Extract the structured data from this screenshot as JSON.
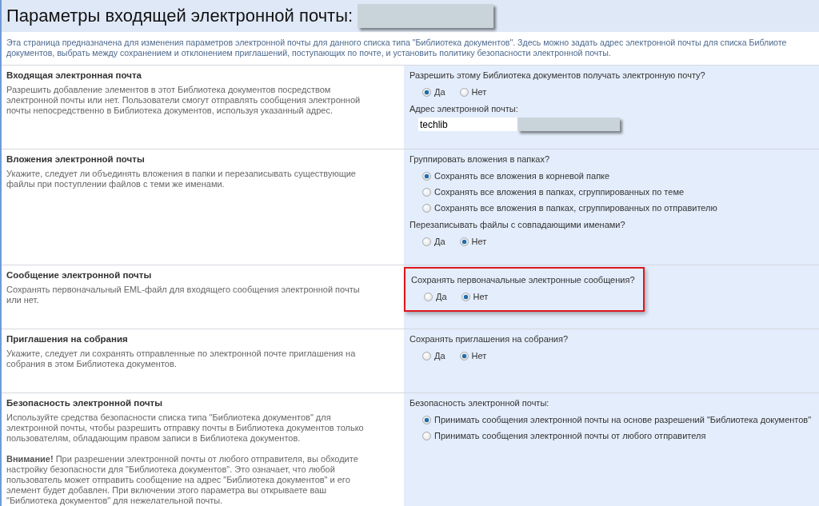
{
  "page": {
    "title": "Параметры входящей электронной почты:",
    "intro_lines": [
      "Эта страница предназначена для изменения параметров электронной почты для данного списка типа \"Библиотека документов\". Здесь можно задать адрес электронной почты для списка Библиоте",
      "документов, выбрать между сохранением и отклонением приглашений, поступающих по почте, и установить политику безопасности электронной почты."
    ]
  },
  "sections": [
    {
      "title": "Входящая электронная почта",
      "description": [
        "Разрешить добавление элементов в этот Библиотека документов посредством электронной почты или нет. Пользователи смогут отправлять сообщения электронной почты непосредственно в Библиотека документов, используя указанный адрес."
      ],
      "highlighted": false,
      "controls": [
        {
          "kind": "question",
          "text": "Разрешить этому Библиотека документов получать электронную почту?"
        },
        {
          "kind": "inline-radios",
          "options": [
            {
              "label": "Да",
              "selected": true
            },
            {
              "label": "Нет",
              "selected": false
            }
          ]
        },
        {
          "kind": "question",
          "text": "Адрес электронной почты:"
        },
        {
          "kind": "text-field",
          "value": "techlib"
        }
      ]
    },
    {
      "title": "Вложения электронной почты",
      "description": [
        "Укажите, следует ли объединять вложения в папки и перезаписывать существующие файлы при поступлении файлов с теми же именами."
      ],
      "highlighted": false,
      "controls": [
        {
          "kind": "question",
          "text": "Группировать вложения в папках?"
        },
        {
          "kind": "stacked-radios",
          "options": [
            {
              "label": "Сохранять все вложения в корневой папке",
              "selected": true
            },
            {
              "label": "Сохранять все вложения в папках, сгруппированных по теме",
              "selected": false
            },
            {
              "label": "Сохранять все вложения в папках, сгруппированных по отправителю",
              "selected": false
            }
          ]
        },
        {
          "kind": "question",
          "text": "Перезаписывать файлы с совпадающими именами?"
        },
        {
          "kind": "inline-radios",
          "options": [
            {
              "label": "Да",
              "selected": false
            },
            {
              "label": "Нет",
              "selected": true
            }
          ]
        }
      ]
    },
    {
      "title": "Сообщение электронной почты",
      "description": [
        "Сохранять первоначальный EML-файл для входящего сообщения электронной почты или нет."
      ],
      "highlighted": true,
      "controls": [
        {
          "kind": "question",
          "text": "Сохранять первоначальные электронные сообщения?"
        },
        {
          "kind": "inline-radios",
          "options": [
            {
              "label": "Да",
              "selected": false
            },
            {
              "label": "Нет",
              "selected": true
            }
          ]
        }
      ]
    },
    {
      "title": "Приглашения на собрания",
      "description": [
        "Укажите, следует ли сохранять отправленные по электронной почте приглашения на собрания в этом Библиотека документов."
      ],
      "highlighted": false,
      "controls": [
        {
          "kind": "question",
          "text": "Сохранять приглашения на собрания?"
        },
        {
          "kind": "inline-radios",
          "options": [
            {
              "label": "Да",
              "selected": false
            },
            {
              "label": "Нет",
              "selected": true
            }
          ]
        }
      ]
    },
    {
      "title": "Безопасность электронной почты",
      "description": [
        "Используйте средства безопасности списка типа \"Библиотека документов\" для электронной почты, чтобы разрешить отправку почты в Библиотека документов только пользователям, обладающим правом записи в Библиотека документов.",
        "**Внимание!** При разрешении электронной почты от любого отправителя, вы обходите настройку безопасности для \"Библиотека документов\". Это означает, что любой пользователь может отправить сообщение на адрес \"Библиотека документов\" и его элемент будет добавлен. При включении этого параметра вы открываете ваш \"Библиотека документов\" для нежелательной почты."
      ],
      "highlighted": false,
      "controls": [
        {
          "kind": "question",
          "text": "Безопасность электронной почты:"
        },
        {
          "kind": "stacked-radios",
          "options": [
            {
              "label": "Принимать сообщения электронной почты на основе разрешений \"Библиотека документов\"",
              "selected": true
            },
            {
              "label": "Принимать сообщения электронной почты от любого отправителя",
              "selected": false
            }
          ]
        }
      ]
    }
  ]
}
